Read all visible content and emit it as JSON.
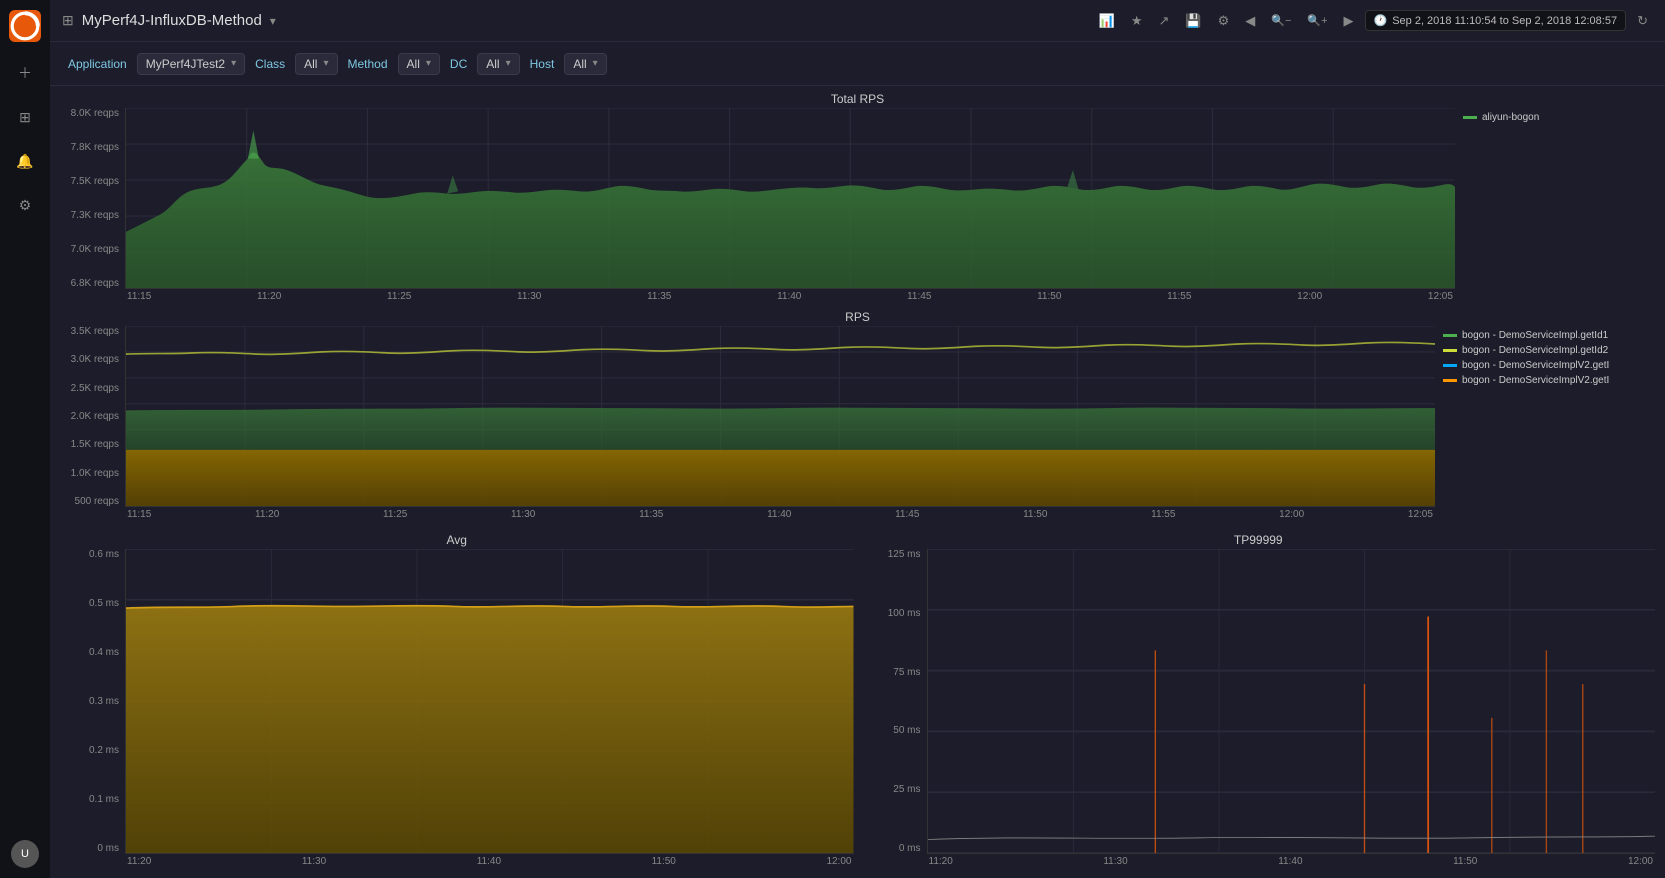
{
  "app": {
    "title": "MyPerf4J-InfluxDB-Method",
    "title_arrow": "▾"
  },
  "topbar": {
    "icons": [
      "⊞",
      "★",
      "↗",
      "💾",
      "⚙",
      "◀",
      "🔍−",
      "🔍+",
      "▶"
    ],
    "time_range": "Sep 2, 2018 11:10:54 to Sep 2, 2018 12:08:57",
    "refresh_icon": "↻"
  },
  "filterbar": {
    "application_label": "Application",
    "application_value": "MyPerf4JTest2",
    "class_label": "Class",
    "class_all": "All",
    "method_label": "Method",
    "method_all": "All",
    "dc_label": "DC",
    "dc_all": "All",
    "host_label": "Host",
    "host_all": "All"
  },
  "chart1": {
    "title": "Total RPS",
    "yaxis": [
      "8.0K reqps",
      "7.8K reqps",
      "7.5K reqps",
      "7.3K reqps",
      "7.0K reqps",
      "6.8K reqps"
    ],
    "xaxis": [
      "11:15",
      "11:20",
      "11:25",
      "11:30",
      "11:35",
      "11:40",
      "11:45",
      "11:50",
      "11:55",
      "12:00",
      "12:05"
    ],
    "legend": [
      {
        "label": "aliyun-bogon",
        "color": "#4caf50"
      }
    ]
  },
  "chart2": {
    "title": "RPS",
    "yaxis": [
      "3.5K reqps",
      "3.0K reqps",
      "2.5K reqps",
      "2.0K reqps",
      "1.5K reqps",
      "1.0K reqps",
      "500 reqps"
    ],
    "xaxis": [
      "11:15",
      "11:20",
      "11:25",
      "11:30",
      "11:35",
      "11:40",
      "11:45",
      "11:50",
      "11:55",
      "12:00",
      "12:05"
    ],
    "legend": [
      {
        "label": "bogon - DemoServiceImpl.getId1",
        "color": "#4caf50"
      },
      {
        "label": "bogon - DemoServiceImpl.getId2",
        "color": "#cddc39"
      },
      {
        "label": "bogon - DemoServiceImplV2.getI",
        "color": "#03a9f4"
      },
      {
        "label": "bogon - DemoServiceImplV2.getI",
        "color": "#ff9800"
      }
    ]
  },
  "chart3": {
    "title": "Avg",
    "yaxis": [
      "0.6 ms",
      "0.5 ms",
      "0.4 ms",
      "0.3 ms",
      "0.2 ms",
      "0.1 ms",
      "0 ms"
    ],
    "xaxis": [
      "11:20",
      "11:30",
      "11:40",
      "11:50",
      "12:00"
    ]
  },
  "chart4": {
    "title": "TP99999",
    "yaxis": [
      "125 ms",
      "100 ms",
      "75 ms",
      "50 ms",
      "25 ms",
      "0 ms"
    ],
    "xaxis": [
      "11:20",
      "11:30",
      "11:40",
      "11:50",
      "12:00"
    ]
  },
  "colors": {
    "green": "#4caf50",
    "gold": "#b8860b",
    "chart_bg": "#1c1c2a",
    "grid": "#2a2a3a",
    "accent_orange": "#e8580a"
  }
}
